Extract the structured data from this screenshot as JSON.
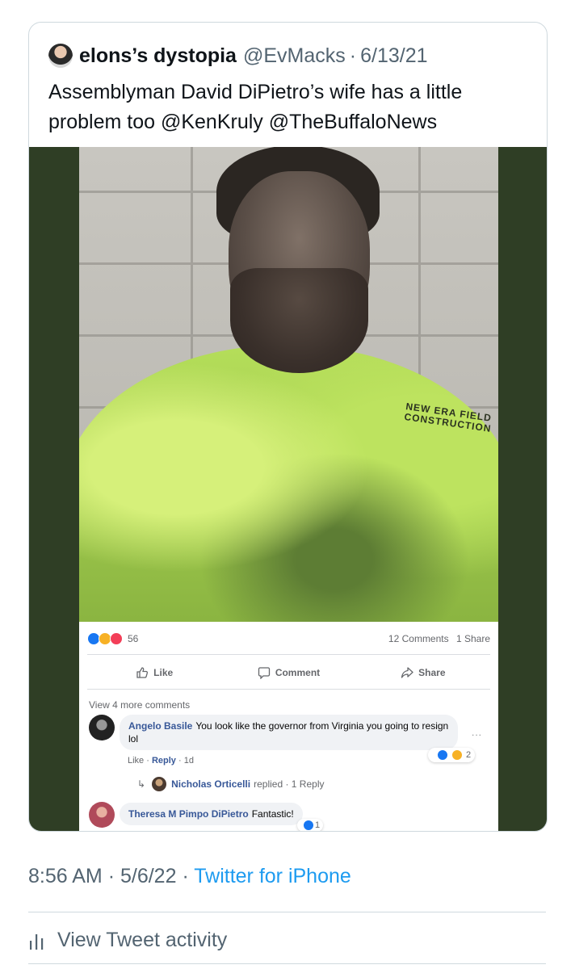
{
  "quoted_tweet": {
    "display_name": "elons’s dystopia",
    "handle": "@EvMacks",
    "separator": "·",
    "date": "6/13/21",
    "text": "Assemblyman David DiPietro’s wife has a little problem too @KenKruly @TheBuffaloNews"
  },
  "fb_post": {
    "shirt_logo": "NEW ERA FIELD CONSTRUCTION",
    "reaction_count": "56",
    "comments_count": "12 Comments",
    "shares_count": "1 Share",
    "actions": {
      "like": "Like",
      "comment": "Comment",
      "share": "Share"
    },
    "view_more": "View 4 more comments",
    "comment1": {
      "author": "Angelo Basile",
      "text": "You look like the governor from Virginia you going to resign lol",
      "like_label": "Like",
      "reply_label": "Reply",
      "age": "1d",
      "reactions": "2",
      "dots": "..."
    },
    "reply_summary": {
      "author": "Nicholas Orticelli",
      "text": "replied · 1 Reply"
    },
    "comment2": {
      "author": "Theresa M Pimpo DiPietro",
      "text": "Fantastic!",
      "reactions": "1"
    }
  },
  "footer": {
    "time": "8:56 AM",
    "separator": "·",
    "date": "5/6/22",
    "source": "Twitter for iPhone",
    "activity_label": "View Tweet activity"
  },
  "colors": {
    "twitter_blue": "#1d9bf0",
    "muted": "#536471",
    "fb_link": "#385898",
    "media_bg": "#2f3e25"
  }
}
